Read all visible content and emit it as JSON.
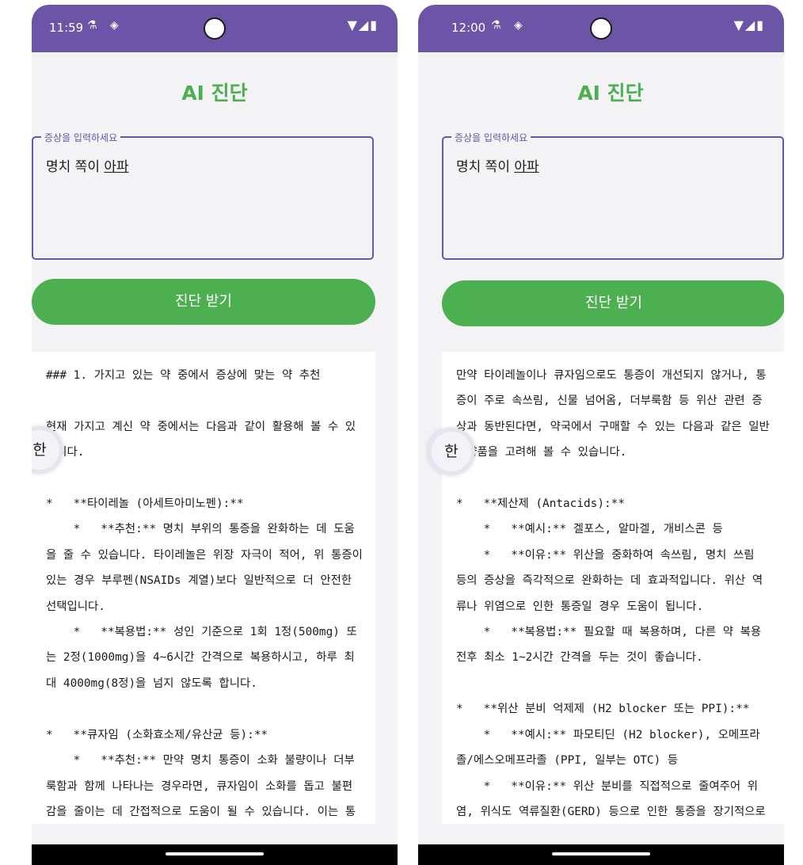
{
  "screens": [
    {
      "status": {
        "time": "11:59",
        "left_icons": "⚗ ◈",
        "right_icons": "▼◢▮"
      },
      "title": "AI 진단",
      "input": {
        "label": "증상을 입력하세요",
        "value_plain": "명치 쪽이 ",
        "value_underlined": "아파"
      },
      "button_label": "진단 받기",
      "ime_label": "한",
      "result_text": "### 1. 가지고 있는 약 중에서 증상에 맞는 약 추천\n\n현재 가지고 계신 약 중에서는 다음과 같이 활용해 볼 수 있습니다.\n\n*   **타이레놀 (아세트아미노펜):**\n    *   **추천:** 명치 부위의 통증을 완화하는 데 도움을 줄 수 있습니다. 타이레놀은 위장 자극이 적어, 위 통증이 있는 경우 부루펜(NSAIDs 계열)보다 일반적으로 더 안전한 선택입니다.\n    *   **복용법:** 성인 기준으로 1회 1정(500mg) 또는 2정(1000mg)을 4~6시간 간격으로 복용하시고, 하루 최대 4000mg(8정)을 넘지 않도록 합니다.\n\n*   **큐자임 (소화효소제/유산균 등):**\n    *   **추천:** 만약 명치 통증이 소화 불량이나 더부룩함과 함께 나타나는 경우라면, 큐자임이 소화를 돕고 불편감을 줄이는 데 간접적으로 도움이 될 수 있습니다. 이는 통증 자체를 직접적으로 완화하기보다는,"
    },
    {
      "status": {
        "time": "12:00",
        "left_icons": "⚗ ◈",
        "right_icons": "▼◢▮"
      },
      "title": "AI 진단",
      "input": {
        "label": "증상을 입력하세요",
        "value_plain": "명치 쪽이 ",
        "value_underlined": "아파"
      },
      "button_label": "진단 받기",
      "ime_label": "한",
      "result_text": "만약 타이레놀이나 큐자임으로도 통증이 개선되지 않거나, 통증이 주로 속쓰림, 신물 넘어옴, 더부룩함 등 위산 관련 증상과 동반된다면, 약국에서 구매할 수 있는 다음과 같은 일반의약품을 고려해 볼 수 있습니다.\n\n*   **제산제 (Antacids):**\n    *   **예시:** 겔포스, 알마겔, 개비스콘 등\n    *   **이유:** 위산을 중화하여 속쓰림, 명치 쓰림 등의 증상을 즉각적으로 완화하는 데 효과적입니다. 위산 역류나 위염으로 인한 통증일 경우 도움이 됩니다.\n    *   **복용법:** 필요할 때 복용하며, 다른 약 복용 전후 최소 1~2시간 간격을 두는 것이 좋습니다.\n\n*   **위산 분비 억제제 (H2 blocker 또는 PPI):**\n    *   **예시:** 파모티딘 (H2 blocker), 오메프라졸/에스오메프라졸 (PPI, 일부는 OTC) 등\n    *   **이유:** 위산 분비를 직접적으로 줄여주어 위염, 위식도 역류질환(GERD) 등으로 인한 통증을 장기적으로 조절하는 데 효과적입니다. 제산제보다 작용 시"
    }
  ]
}
